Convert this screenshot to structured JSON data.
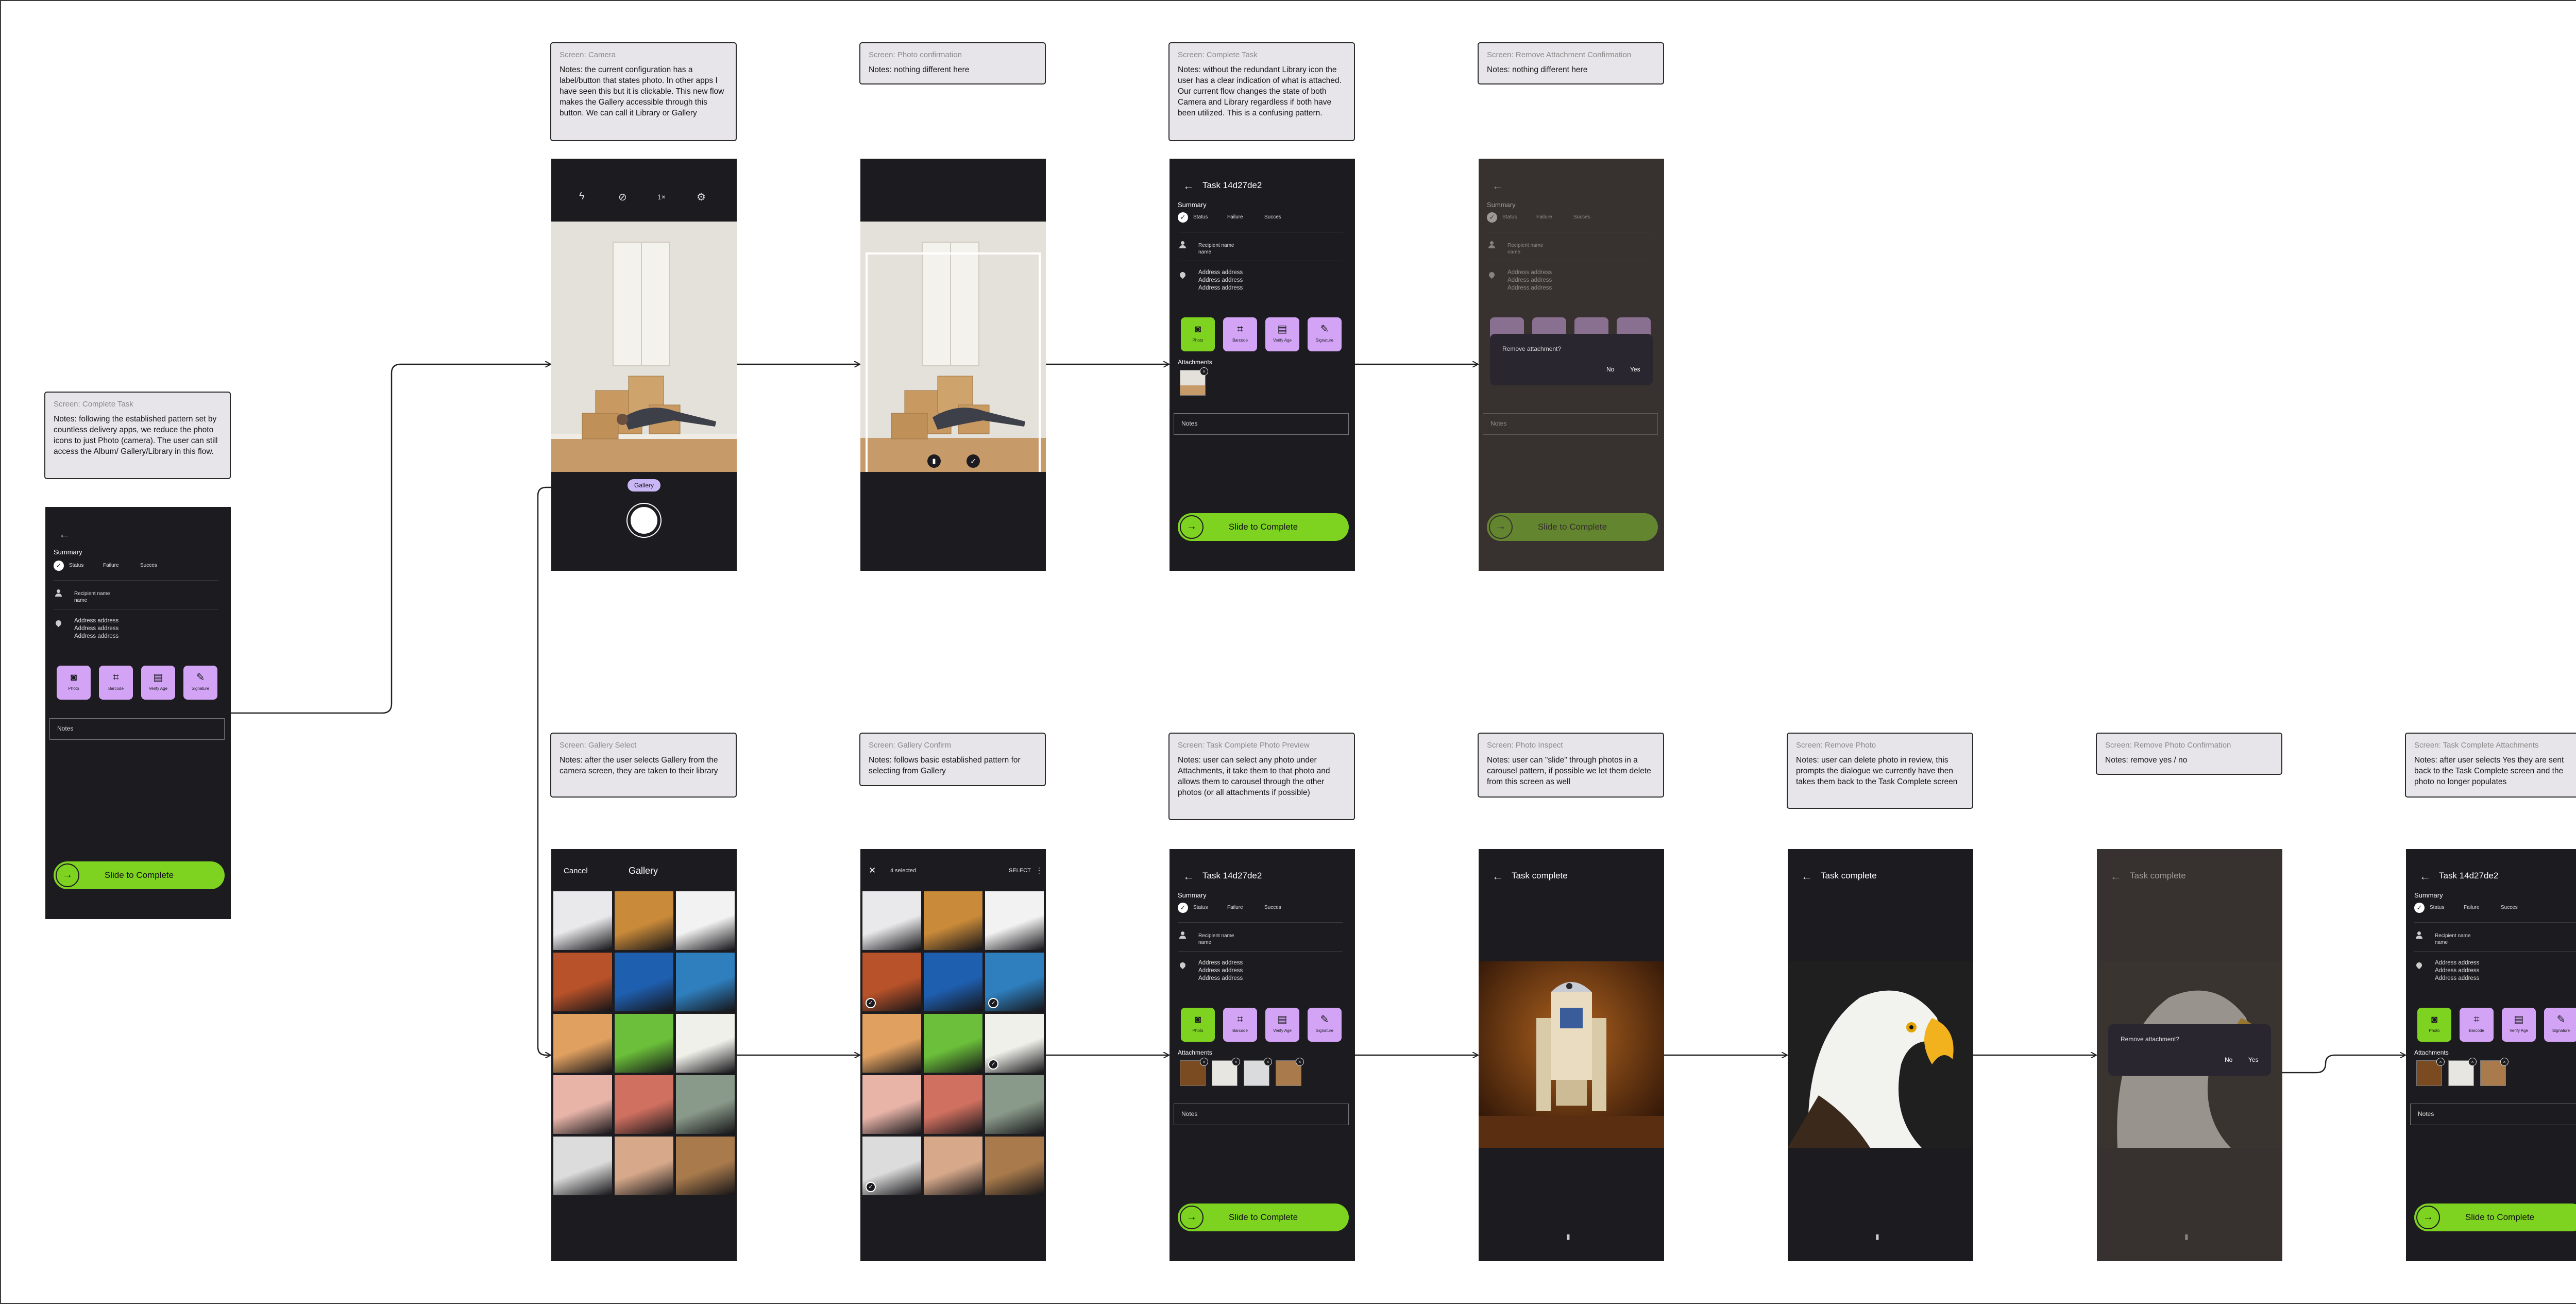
{
  "notes": {
    "complete_task_left": {
      "title": "Screen: Complete Task",
      "body": "Notes: following the established pattern set by countless delivery apps, we reduce the photo icons to just Photo (camera). The user can still  access the Album/ Gallery/Library in this flow."
    },
    "camera": {
      "title": "Screen: Camera",
      "body": "Notes: the current configuration has a label/button that states photo. In other apps I have seen this but it is clickable. This new flow makes the Gallery accessible through this button. We can call it Library or Gallery"
    },
    "photo_confirmation": {
      "title": "Screen: Photo confirmation",
      "body": "Notes: nothing different here"
    },
    "complete_task_top": {
      "title": "Screen: Complete Task",
      "body": "Notes: without the redundant Library icon the user has a clear indication of what is attached. Our current flow changes the state of both Camera and Library regardless if both have been utilized. This is a confusing pattern."
    },
    "remove_attachment_confirmation": {
      "title": "Screen: Remove Attachment Confirmation",
      "body": "Notes: nothing different here"
    },
    "gallery_select": {
      "title": "Screen: Gallery Select",
      "body": "Notes: after the user selects Gallery from the camera screen, they are taken to their library"
    },
    "gallery_confirm": {
      "title": "Screen: Gallery Confirm",
      "body": "Notes: follows basic established pattern for selecting from Gallery"
    },
    "photo_preview": {
      "title": "Screen: Task Complete Photo Preview",
      "body": "Notes: user can select any photo under Attachments, it take them to that photo and allows them to carousel through the other photos (or all attachments if possible)"
    },
    "photo_inspect": {
      "title": "Screen: Photo Inspect",
      "body": "Notes: user can \"slide\" through photos in a carousel pattern, if possible we let them delete from this screen as well"
    },
    "remove_photo": {
      "title": "Screen: Remove Photo",
      "body": "Notes: user can delete photo in review, this prompts the dialogue we currently have then takes them back to the Task Complete screen"
    },
    "remove_photo_confirmation": {
      "title": "Screen: Remove Photo Confirmation",
      "body": "Notes: remove yes / no"
    },
    "task_complete_attachments": {
      "title": "Screen: Task Complete Attachments",
      "body": "Notes: after user selects Yes they are sent back to the Task Complete screen and the photo no longer populates"
    }
  },
  "task": {
    "title": "Task 14d27de2",
    "summary": "Summary",
    "status": "Status",
    "failure": "Failure",
    "success": "Succes",
    "recipient": "Recipient name",
    "recipient_sub": "name",
    "address1": "Address address",
    "address2": "Address address",
    "address3": "Address address",
    "actions": [
      "Photo",
      "Barcode",
      "Verify Age",
      "Signature"
    ],
    "attachments": "Attachments",
    "notes": "Notes",
    "slide": "Slide to Complete",
    "task_complete": "Task complete"
  },
  "camera": {
    "zoom": "1×",
    "gallery": "Gallery"
  },
  "gallery": {
    "cancel": "Cancel",
    "title": "Gallery",
    "selected": "4 selected",
    "select": "SELECT"
  },
  "dialogs": {
    "remove_attachment": "Remove attachment?",
    "no": "No",
    "yes": "Yes"
  },
  "colors": {
    "accent": "#7ed321",
    "action": "#d3a4f6",
    "phone_bg": "#1c1b1f",
    "gallery_pill": "#c9b7f5"
  }
}
